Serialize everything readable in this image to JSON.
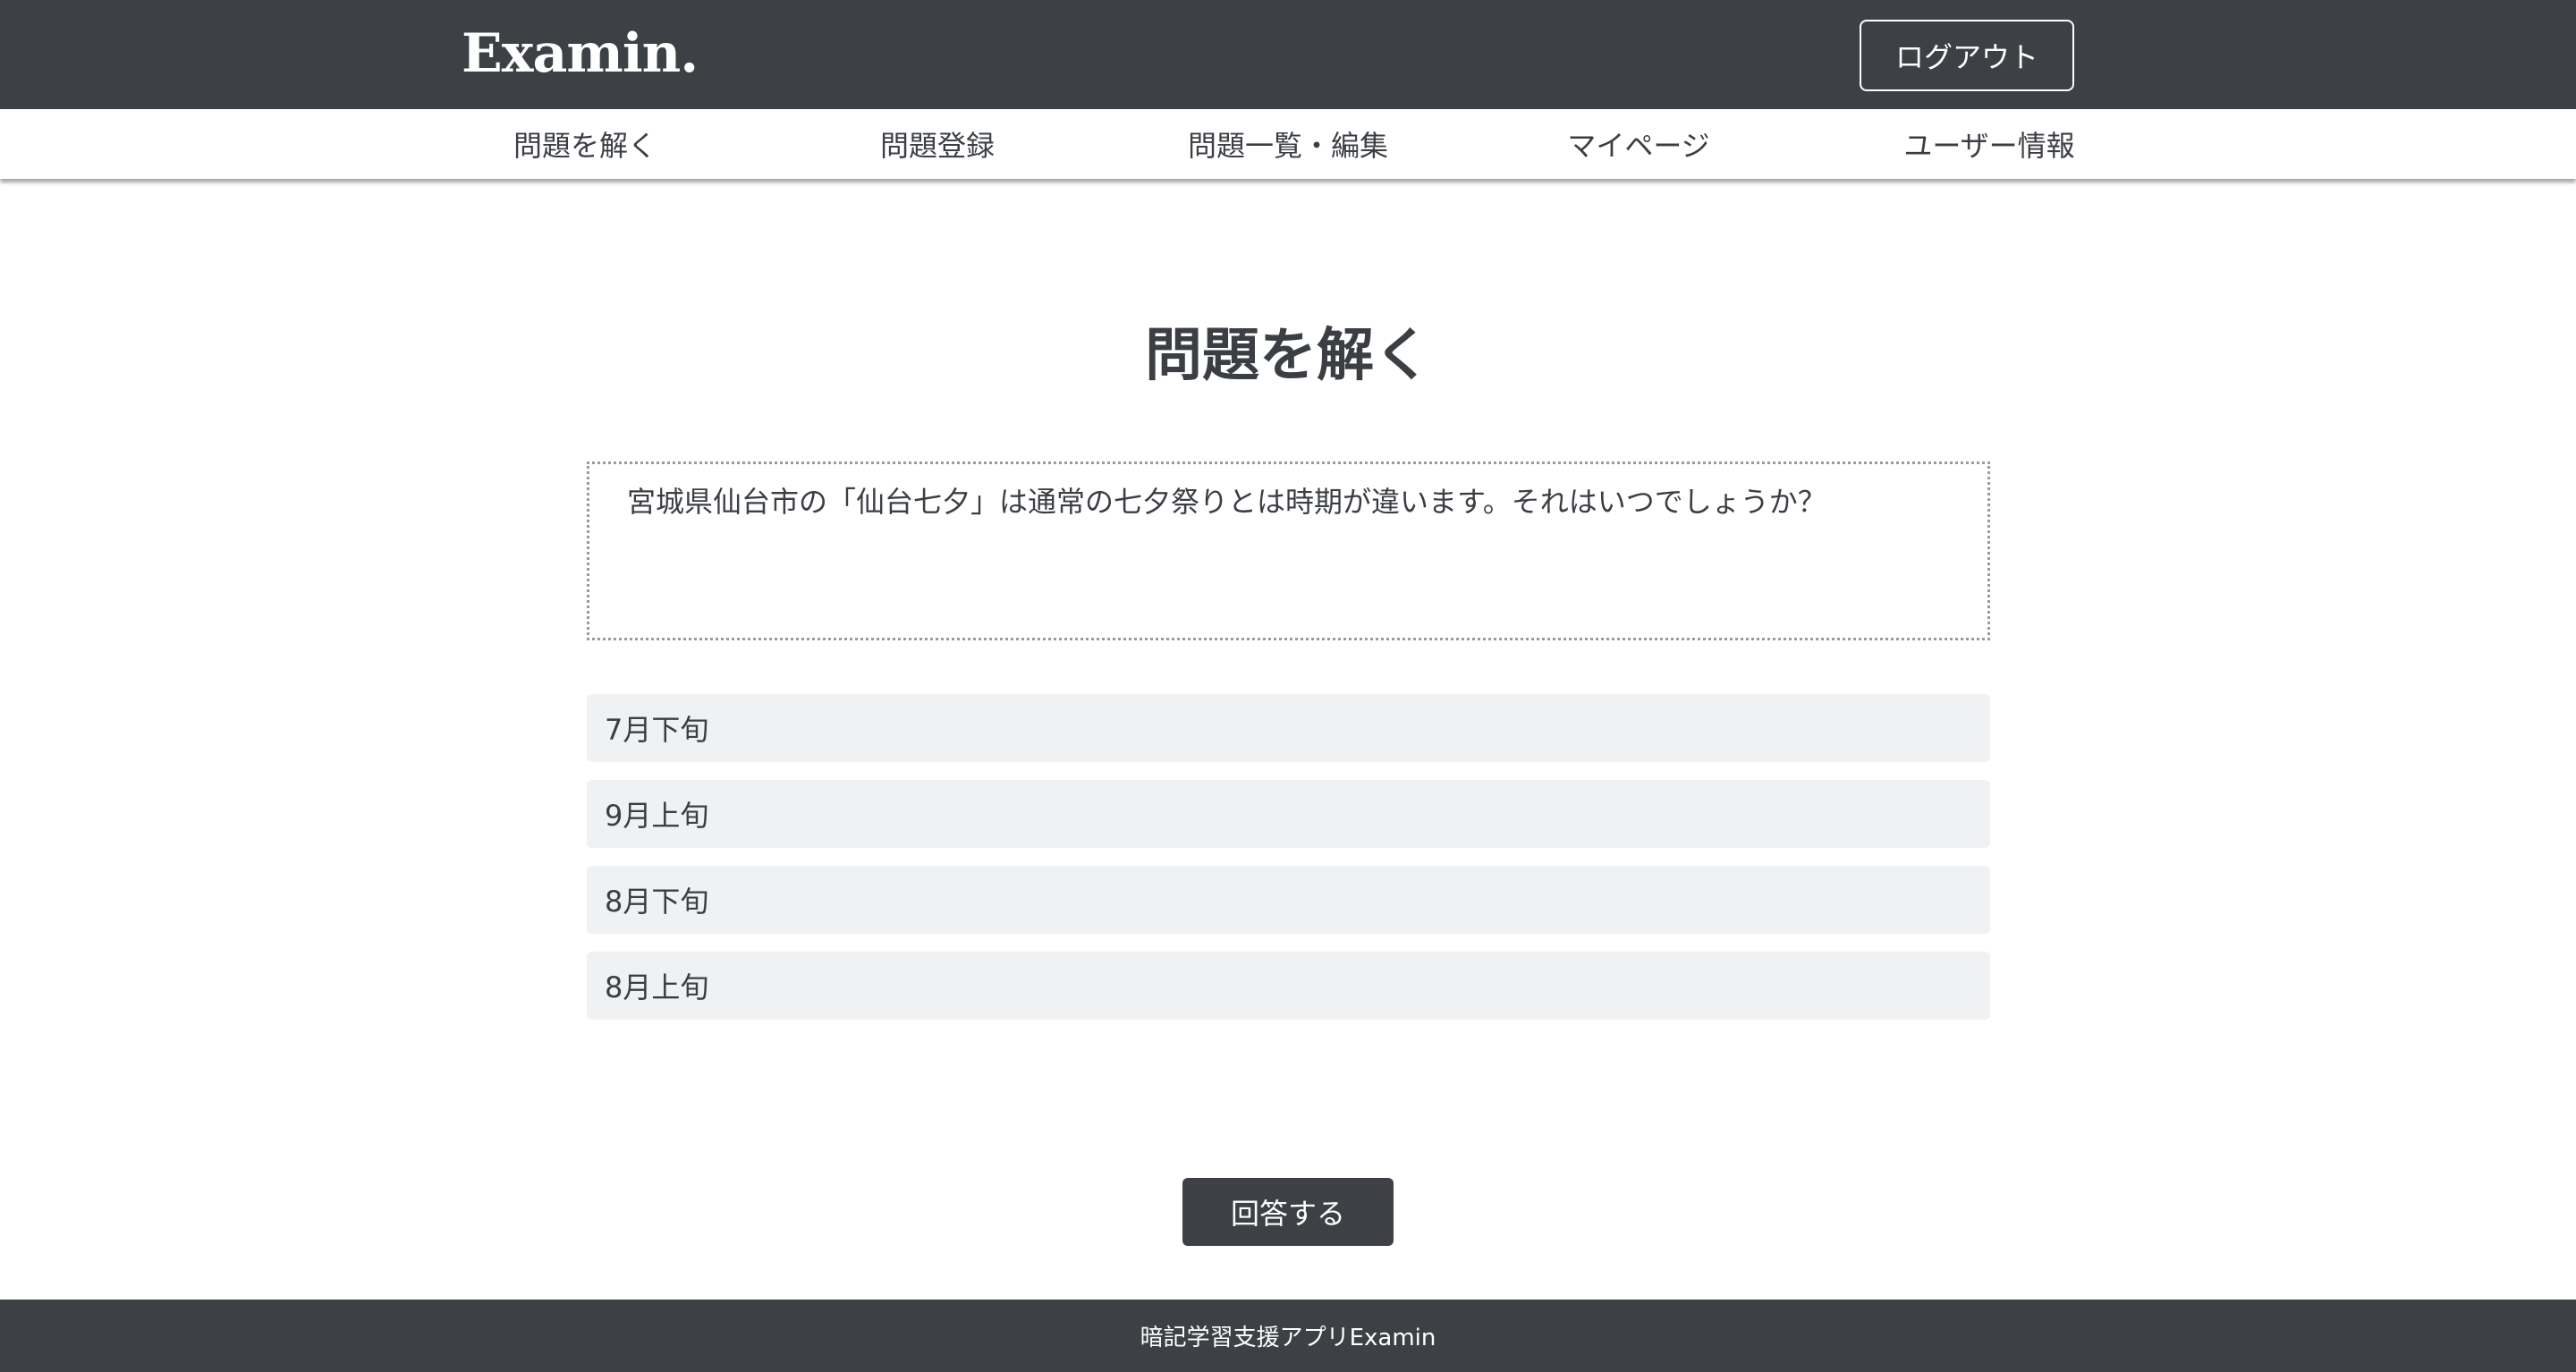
{
  "header": {
    "logo": "Examin.",
    "logout_label": "ログアウト"
  },
  "nav": {
    "items": [
      {
        "label": "問題を解く"
      },
      {
        "label": "問題登録"
      },
      {
        "label": "問題一覧・編集"
      },
      {
        "label": "マイページ"
      },
      {
        "label": "ユーザー情報"
      }
    ]
  },
  "main": {
    "title": "問題を解く",
    "question": "宮城県仙台市の「仙台七夕」は通常の七夕祭りとは時期が違います。それはいつでしょうか？",
    "choices": [
      {
        "label": "7月下旬"
      },
      {
        "label": "9月上旬"
      },
      {
        "label": "8月下旬"
      },
      {
        "label": "8月上旬"
      }
    ],
    "submit_label": "回答する"
  },
  "footer": {
    "text": "暗記学習支援アプリExamin"
  },
  "colors": {
    "header_bg": "#3d4145",
    "choice_bg": "#f0f1f2",
    "text": "#3b3f44"
  }
}
